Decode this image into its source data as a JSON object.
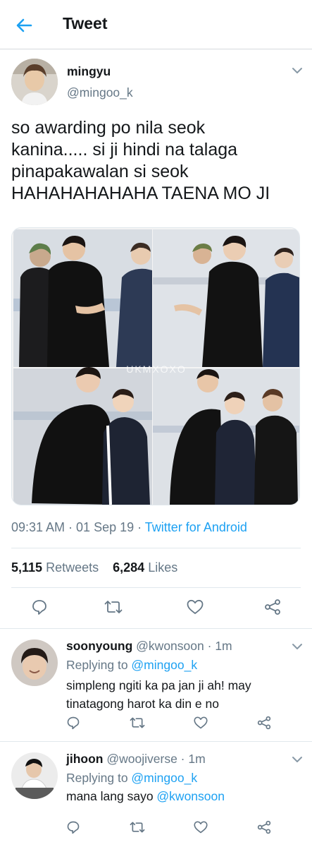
{
  "header": {
    "title": "Tweet"
  },
  "tweet": {
    "display_name": "mingyu",
    "handle": "@mingoo_k",
    "text_lines": [
      "so awarding po nila seok",
      "kanina..... si ji hindi na talaga",
      "pinapakawalan si seok",
      "HAHAHAHAHAHA TAENA MO JI"
    ],
    "photo_watermark": "UKMXOXO",
    "time": "09:31 AM · 01 Sep 19 · ",
    "source": "Twitter for Android",
    "retweets_count": "5,115",
    "retweets_label": "Retweets",
    "likes_count": "6,284",
    "likes_label": "Likes"
  },
  "replies": [
    {
      "display_name": "soonyoung",
      "handle": "@kwonsoon",
      "time": "· 1m",
      "replying_prefix": "Replying to ",
      "replying_to": "@mingoo_k",
      "line1": "simpleng ngiti ka pa jan ji ah! may",
      "line2": "tinatagong harot ka din e no",
      "mention": ""
    },
    {
      "display_name": "jihoon",
      "handle": "@woojiverse",
      "time": "· 1m",
      "replying_prefix": "Replying to ",
      "replying_to": "@mingoo_k",
      "line1": "mana lang sayo ",
      "line2": "",
      "mention": "@kwonsoon"
    }
  ],
  "icons": [
    "back-arrow-icon",
    "chevron-down-icon",
    "reply-icon",
    "retweet-icon",
    "like-icon",
    "share-icon"
  ],
  "colors": {
    "accent": "#1da1f2",
    "text": "#14171a",
    "muted": "#657786",
    "divider": "#e1e8ed"
  }
}
